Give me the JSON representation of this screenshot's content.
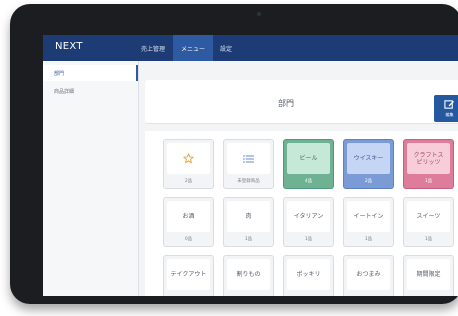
{
  "app": {
    "brand": "NEXT"
  },
  "nav": {
    "sales": "売上管理",
    "menu": "メニュー",
    "settings": "設定"
  },
  "sidebar": {
    "items": [
      {
        "label": "部門"
      },
      {
        "label": "商品詳細"
      }
    ]
  },
  "main": {
    "title": "部門",
    "edit_label": "編集",
    "tiles": [
      {
        "icon": "star-icon",
        "label": "",
        "count": "2品",
        "color": ""
      },
      {
        "icon": "list-icon",
        "label": "",
        "count": "未登録商品",
        "color": ""
      },
      {
        "label": "ビール",
        "count": "4品",
        "color": "#6fb293"
      },
      {
        "label": "ウイスキー",
        "count": "2品",
        "color": "#7b9bd6"
      },
      {
        "label": "クラフトスピリッツ",
        "count": "1品",
        "color": "#dd7c9b"
      },
      {
        "label": "お酒",
        "count": "0品",
        "color": ""
      },
      {
        "label": "肉",
        "count": "1品",
        "color": ""
      },
      {
        "label": "イタリアン",
        "count": "1品",
        "color": ""
      },
      {
        "label": "イートイン",
        "count": "1品",
        "color": ""
      },
      {
        "label": "スイーツ",
        "count": "1品",
        "color": ""
      },
      {
        "label": "テイクアウト",
        "count": "",
        "color": ""
      },
      {
        "label": "割りもの",
        "count": "",
        "color": ""
      },
      {
        "label": "ポッキリ",
        "count": "",
        "color": ""
      },
      {
        "label": "おつまみ",
        "count": "",
        "color": ""
      },
      {
        "label": "期間限定",
        "count": "",
        "color": ""
      }
    ]
  }
}
